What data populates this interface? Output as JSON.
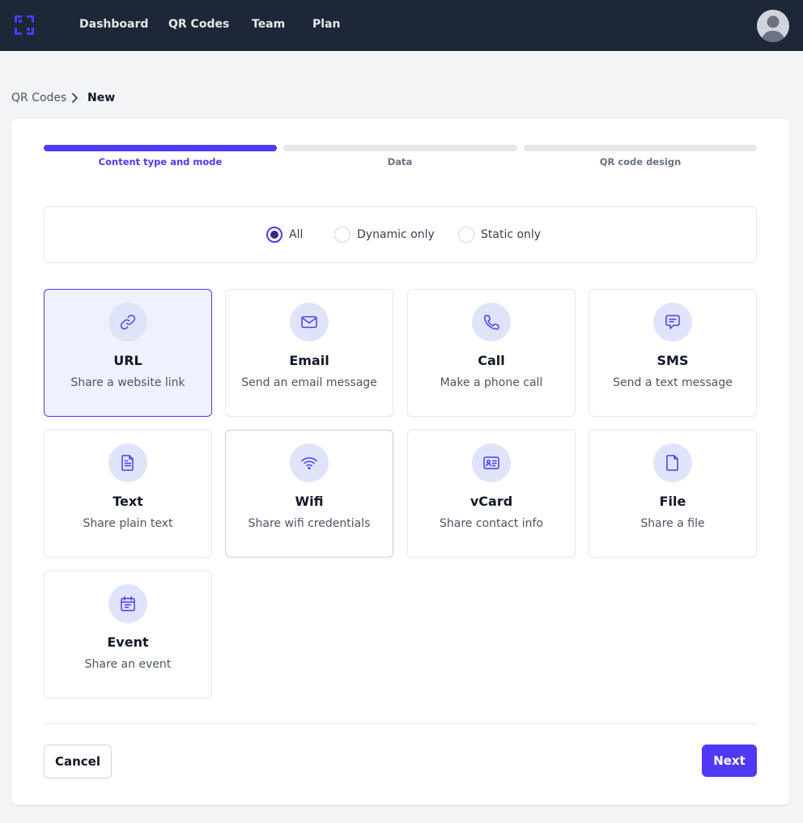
{
  "nav": {
    "logo_icon": "qr-scan-logo-icon",
    "links": [
      "Dashboard",
      "QR Codes",
      "Team",
      "Plan"
    ],
    "avatar_icon": "user-avatar-icon"
  },
  "breadcrumb": {
    "parent": "QR Codes",
    "separator_icon": "chevron-right-icon",
    "current": "New"
  },
  "steps": [
    {
      "label": "Content type and mode",
      "active": true
    },
    {
      "label": "Data",
      "active": false
    },
    {
      "label": "QR code design",
      "active": false
    }
  ],
  "mode_filter": {
    "options": [
      "All",
      "Dynamic only",
      "Static only"
    ],
    "selected": "All"
  },
  "content_types": [
    {
      "title": "URL",
      "description": "Share a website link",
      "icon": "link-icon",
      "selected": true
    },
    {
      "title": "Email",
      "description": "Send an email message",
      "icon": "envelope-icon"
    },
    {
      "title": "Call",
      "description": "Make a phone call",
      "icon": "phone-icon"
    },
    {
      "title": "SMS",
      "description": "Send a text message",
      "icon": "chat-bubble-icon"
    },
    {
      "title": "Text",
      "description": "Share plain text",
      "icon": "document-text-icon"
    },
    {
      "title": "Wifi",
      "description": "Share wifi credentials",
      "icon": "wifi-icon"
    },
    {
      "title": "vCard",
      "description": "Share contact info",
      "icon": "contact-card-icon"
    },
    {
      "title": "File",
      "description": "Share a file",
      "icon": "file-icon"
    },
    {
      "title": "Event",
      "description": "Share an event",
      "icon": "calendar-icon"
    }
  ],
  "actions": {
    "cancel_label": "Cancel",
    "next_label": "Next"
  },
  "colors": {
    "topbar": "#1e2737",
    "accent": "#4f39f6",
    "selected_card_bg": "#eef2ff",
    "icon_circle_bg": "#e0e4fb"
  }
}
